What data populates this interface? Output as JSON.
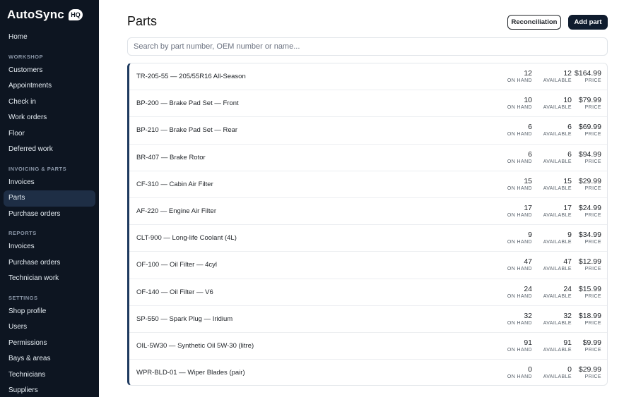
{
  "brand": {
    "name": "AutoSync",
    "badge": "HQ"
  },
  "sidebar": {
    "home": "Home",
    "sections": [
      {
        "title": "WORKSHOP",
        "items": [
          "Customers",
          "Appointments",
          "Check in",
          "Work orders",
          "Floor",
          "Deferred work"
        ]
      },
      {
        "title": "INVOICING & PARTS",
        "items": [
          "Invoices",
          "Parts",
          "Purchase orders"
        ]
      },
      {
        "title": "REPORTS",
        "items": [
          "Invoices",
          "Purchase orders",
          "Technician work"
        ]
      },
      {
        "title": "SETTINGS",
        "items": [
          "Shop profile",
          "Users",
          "Permissions",
          "Bays & areas",
          "Technicians",
          "Suppliers"
        ]
      }
    ],
    "active": "Parts"
  },
  "header": {
    "title": "Parts",
    "reconciliation_label": "Reconciliation",
    "add_part_label": "Add part"
  },
  "search": {
    "placeholder": "Search by part number, OEM number or name..."
  },
  "labels": {
    "on_hand": "ON HAND",
    "available": "AVAILABLE",
    "price": "PRICE"
  },
  "parts": [
    {
      "title": "TR-205-55 — 205/55R16 All-Season",
      "on_hand": "12",
      "available": "12",
      "price": "$164.99"
    },
    {
      "title": "BP-200 — Brake Pad Set — Front",
      "on_hand": "10",
      "available": "10",
      "price": "$79.99"
    },
    {
      "title": "BP-210 — Brake Pad Set — Rear",
      "on_hand": "6",
      "available": "6",
      "price": "$69.99"
    },
    {
      "title": "BR-407 — Brake Rotor",
      "on_hand": "6",
      "available": "6",
      "price": "$94.99"
    },
    {
      "title": "CF-310 — Cabin Air Filter",
      "on_hand": "15",
      "available": "15",
      "price": "$29.99"
    },
    {
      "title": "AF-220 — Engine Air Filter",
      "on_hand": "17",
      "available": "17",
      "price": "$24.99"
    },
    {
      "title": "CLT-900 — Long-life Coolant (4L)",
      "on_hand": "9",
      "available": "9",
      "price": "$34.99"
    },
    {
      "title": "OF-100 — Oil Filter — 4cyl",
      "on_hand": "47",
      "available": "47",
      "price": "$12.99"
    },
    {
      "title": "OF-140 — Oil Filter — V6",
      "on_hand": "24",
      "available": "24",
      "price": "$15.99"
    },
    {
      "title": "SP-550 — Spark Plug — Iridium",
      "on_hand": "32",
      "available": "32",
      "price": "$18.99"
    },
    {
      "title": "OIL-5W30 — Synthetic Oil 5W-30 (litre)",
      "on_hand": "91",
      "available": "91",
      "price": "$9.99"
    },
    {
      "title": "WPR-BLD-01 — Wiper Blades (pair)",
      "on_hand": "0",
      "available": "0",
      "price": "$29.99"
    }
  ]
}
